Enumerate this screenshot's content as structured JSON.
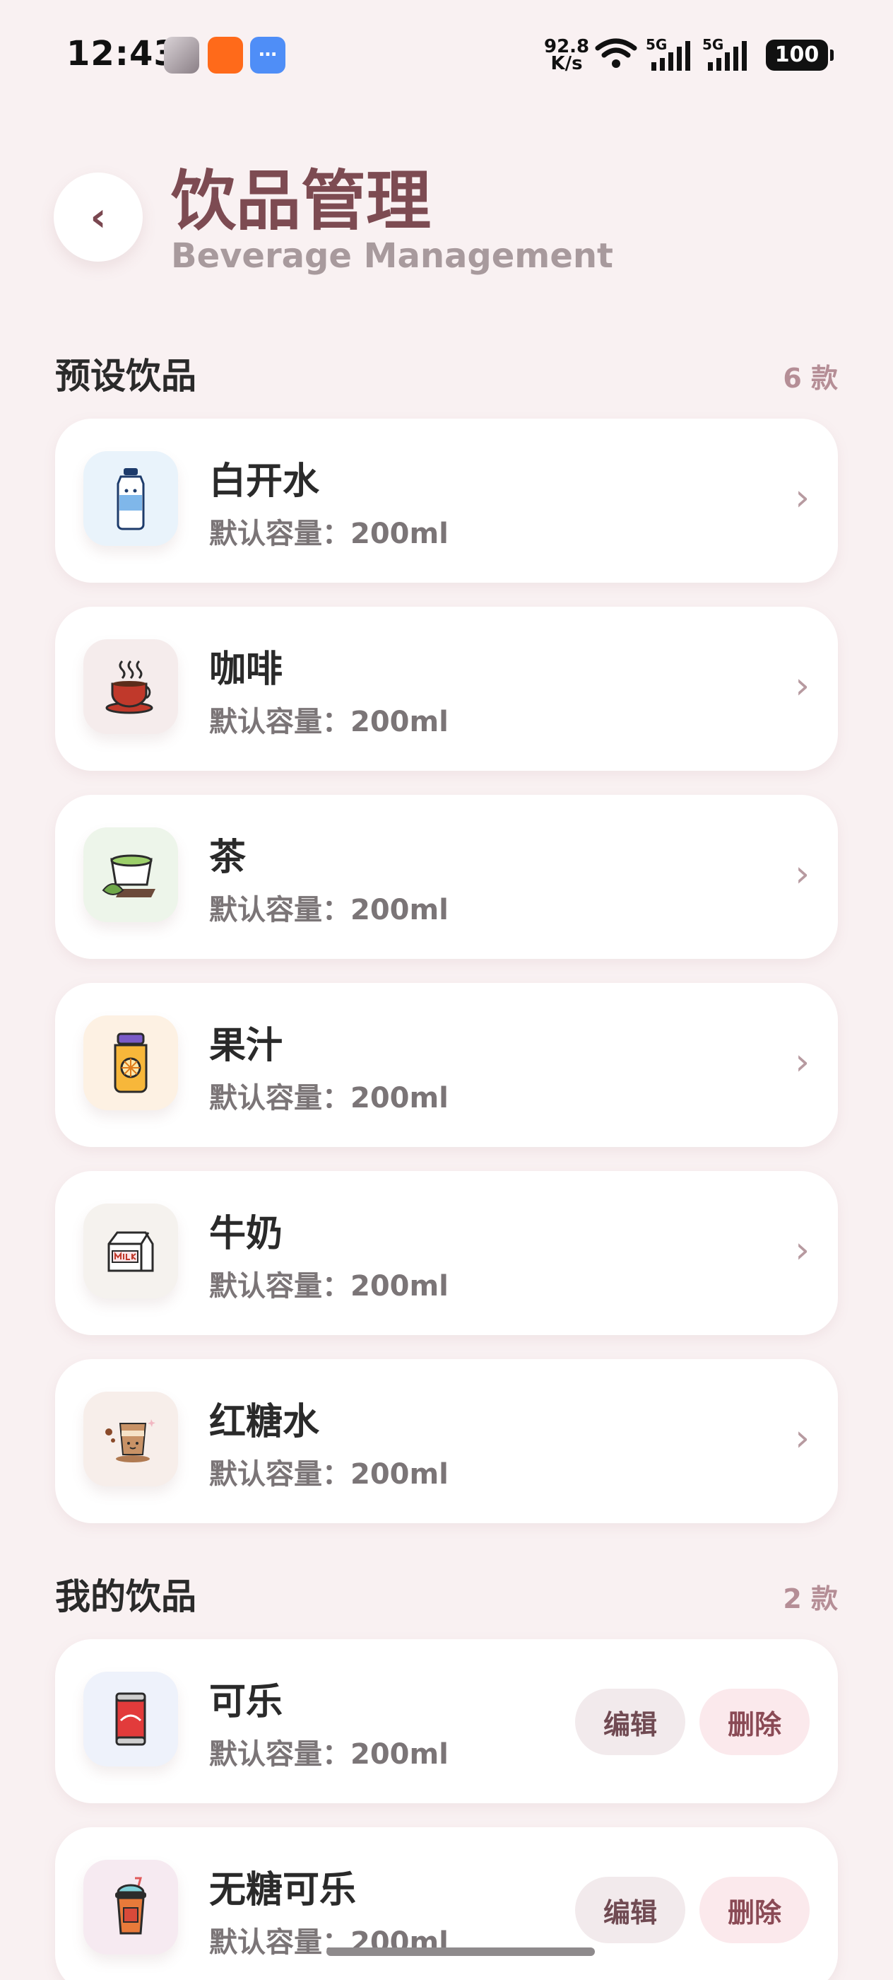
{
  "status_bar": {
    "time": "12:43",
    "net_speed_value": "92.8",
    "net_speed_unit": "K/s",
    "signal1": "5G",
    "signal2": "5G",
    "battery": "100"
  },
  "header": {
    "back_icon": "chevron-left-icon",
    "title": "饮品管理",
    "subtitle": "Beverage Management"
  },
  "preset": {
    "title": "预设饮品",
    "count": "6 款",
    "items": [
      {
        "name": "白开水",
        "capacity": "默认容量：200ml",
        "icon": "water-bottle-icon",
        "bg": "#e9f3fb"
      },
      {
        "name": "咖啡",
        "capacity": "默认容量：200ml",
        "icon": "coffee-cup-icon",
        "bg": "#f5ecec"
      },
      {
        "name": "茶",
        "capacity": "默认容量：200ml",
        "icon": "tea-cup-icon",
        "bg": "#edf5ea"
      },
      {
        "name": "果汁",
        "capacity": "默认容量：200ml",
        "icon": "juice-jar-icon",
        "bg": "#fdf1e3"
      },
      {
        "name": "牛奶",
        "capacity": "默认容量：200ml",
        "icon": "milk-carton-icon",
        "bg": "#f5f2ee"
      },
      {
        "name": "红糖水",
        "capacity": "默认容量：200ml",
        "icon": "brown-sugar-cup-icon",
        "bg": "#f7eeea"
      }
    ]
  },
  "mine": {
    "title": "我的饮品",
    "count": "2 款",
    "edit_label": "编辑",
    "delete_label": "删除",
    "items": [
      {
        "name": "可乐",
        "capacity": "默认容量：200ml",
        "icon": "cola-can-icon",
        "bg": "#eef2fb"
      },
      {
        "name": "无糖可乐",
        "capacity": "默认容量：200ml",
        "icon": "bubble-tea-icon",
        "bg": "#f6eaf1"
      }
    ]
  }
}
